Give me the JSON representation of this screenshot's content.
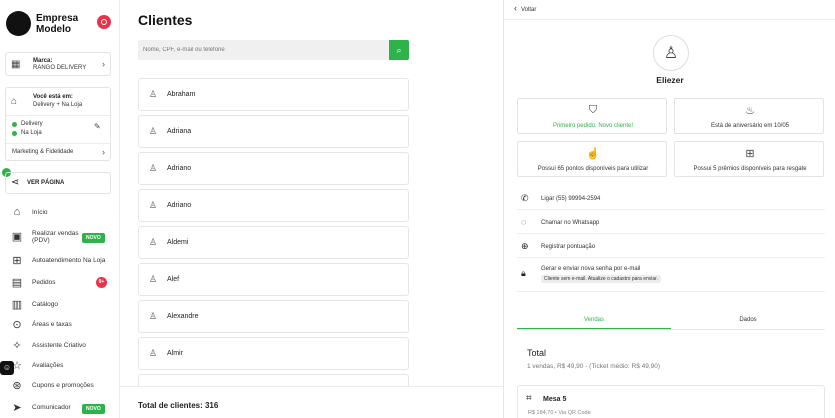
{
  "brand": {
    "name_line1": "Empresa",
    "name_line2": "Modelo"
  },
  "brand_card": {
    "title": "Marca:",
    "value": "RANGO DELIVERY",
    "chevron": "›"
  },
  "location_card": {
    "title": "Você está em:",
    "value": "Delivery + Na Loja",
    "modes": [
      "Delivery",
      "Na Loja"
    ],
    "marketing": "Marketing & Fidelidade",
    "chevron": "›"
  },
  "view_page": {
    "label": "VER PÁGINA"
  },
  "nav": {
    "inicio": "Início",
    "pdv_line1": "Realizar vendas",
    "pdv_line2": "(PDV)",
    "autoatendimento": "Autoatendimento Na Loja",
    "pedidos": "Pedidos",
    "pedidos_count": "9+",
    "catalogo": "Catálogo",
    "areas": "Áreas e taxas",
    "assistente": "Assistente Criativo",
    "avaliacoes": "Avaliações",
    "cupons": "Cupons e promoções",
    "comunicador": "Comunicador",
    "novo": "NOVO"
  },
  "main": {
    "title": "Clientes",
    "search_placeholder": "Nome, CPF, e-mail ou telefone",
    "clients": [
      "Abraham",
      "Adriana",
      "Adriano",
      "Adriano",
      "Aldemi",
      "Alef",
      "Alexandre",
      "Almir"
    ],
    "total_clients": "Total de clientes: 316"
  },
  "detail": {
    "back": "Voltar",
    "name": "Eliezer",
    "cards": {
      "first_order": "Primeiro pedido. Novo cliente!",
      "birthday": "Está de aniversário em 10/05",
      "points": "Possui 65 pontos disponíveis para utilizar",
      "prizes": "Possui 5 prêmios disponíveis para resgate"
    },
    "actions": {
      "call": "Ligar (55) 99994-2594",
      "whatsapp": "Chamar no Whatsapp",
      "points": "Registrar pontuação",
      "password": "Gerar e enviar nova senha por e-mail",
      "password_note": "Cliente sem e-mail. Atualize o cadastro para enviar."
    },
    "tabs": {
      "sales": "Vendas",
      "data": "Dados"
    },
    "total": {
      "label": "Total",
      "sub": "1 vendas, R$ 49,90 - (Ticket médio: R$ 49,90)"
    },
    "order": {
      "title": "Mesa 5",
      "sub": "R$ 184,70 • Via QR Code"
    }
  },
  "colors": {
    "accent": "#2fb24a",
    "alert": "#e8334b"
  }
}
